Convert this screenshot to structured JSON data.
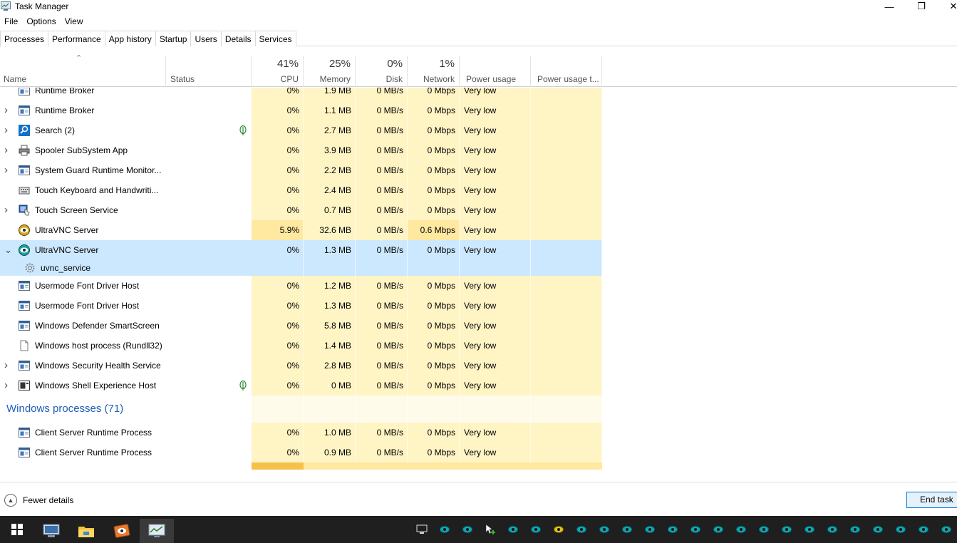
{
  "window": {
    "title": "Task Manager"
  },
  "menu": [
    "File",
    "Options",
    "View"
  ],
  "tabs": [
    "Processes",
    "Performance",
    "App history",
    "Startup",
    "Users",
    "Details",
    "Services"
  ],
  "columns": {
    "name": "Name",
    "status": "Status",
    "cpu": {
      "pct": "41%",
      "label": "CPU"
    },
    "memory": {
      "pct": "25%",
      "label": "Memory"
    },
    "disk": {
      "pct": "0%",
      "label": "Disk"
    },
    "network": {
      "pct": "1%",
      "label": "Network"
    },
    "power": "Power usage",
    "power_trend": "Power usage t..."
  },
  "rows": [
    {
      "kind": "proc",
      "expand": "",
      "icon": "app-window-icon",
      "name": "Runtime Broker",
      "cpu": "0%",
      "mem": "1.9 MB",
      "disk": "0 MB/s",
      "net": "0 Mbps",
      "power": "Very low"
    },
    {
      "kind": "proc",
      "expand": ">",
      "icon": "app-window-icon",
      "name": "Runtime Broker",
      "cpu": "0%",
      "mem": "1.1 MB",
      "disk": "0 MB/s",
      "net": "0 Mbps",
      "power": "Very low"
    },
    {
      "kind": "proc",
      "expand": ">",
      "icon": "search-icon",
      "name": "Search (2)",
      "leaf": true,
      "cpu": "0%",
      "mem": "2.7 MB",
      "disk": "0 MB/s",
      "net": "0 Mbps",
      "power": "Very low"
    },
    {
      "kind": "proc",
      "expand": ">",
      "icon": "printer-icon",
      "name": "Spooler SubSystem App",
      "cpu": "0%",
      "mem": "3.9 MB",
      "disk": "0 MB/s",
      "net": "0 Mbps",
      "power": "Very low"
    },
    {
      "kind": "proc",
      "expand": ">",
      "icon": "app-window-icon",
      "name": "System Guard Runtime Monitor...",
      "cpu": "0%",
      "mem": "2.2 MB",
      "disk": "0 MB/s",
      "net": "0 Mbps",
      "power": "Very low"
    },
    {
      "kind": "proc",
      "expand": "",
      "icon": "keyboard-icon",
      "name": "Touch Keyboard and Handwriti...",
      "cpu": "0%",
      "mem": "2.4 MB",
      "disk": "0 MB/s",
      "net": "0 Mbps",
      "power": "Very low"
    },
    {
      "kind": "proc",
      "expand": ">",
      "icon": "touch-icon",
      "name": "Touch Screen Service",
      "cpu": "0%",
      "mem": "0.7 MB",
      "disk": "0 MB/s",
      "net": "0 Mbps",
      "power": "Very low"
    },
    {
      "kind": "proc",
      "expand": "",
      "icon": "ultravnc-icon",
      "name": "UltraVNC Server",
      "cpu": "5.9%",
      "mem": "32.6 MB",
      "disk": "0 MB/s",
      "net": "0.6 Mbps",
      "power": "Very low",
      "hot": true
    },
    {
      "kind": "proc",
      "expand": "v",
      "icon": "ultravnc-service-icon",
      "name": "UltraVNC Server",
      "cpu": "0%",
      "mem": "1.3 MB",
      "disk": "0 MB/s",
      "net": "0 Mbps",
      "power": "Very low",
      "selected": true
    },
    {
      "kind": "child",
      "icon": "gear-icon",
      "name": "uvnc_service",
      "selected": true
    },
    {
      "kind": "proc",
      "expand": "",
      "icon": "app-window-icon",
      "name": "Usermode Font Driver Host",
      "cpu": "0%",
      "mem": "1.2 MB",
      "disk": "0 MB/s",
      "net": "0 Mbps",
      "power": "Very low"
    },
    {
      "kind": "proc",
      "expand": "",
      "icon": "app-window-icon",
      "name": "Usermode Font Driver Host",
      "cpu": "0%",
      "mem": "1.3 MB",
      "disk": "0 MB/s",
      "net": "0 Mbps",
      "power": "Very low"
    },
    {
      "kind": "proc",
      "expand": "",
      "icon": "app-window-icon",
      "name": "Windows Defender SmartScreen",
      "cpu": "0%",
      "mem": "5.8 MB",
      "disk": "0 MB/s",
      "net": "0 Mbps",
      "power": "Very low"
    },
    {
      "kind": "proc",
      "expand": "",
      "icon": "document-icon",
      "name": "Windows host process (Rundll32)",
      "cpu": "0%",
      "mem": "1.4 MB",
      "disk": "0 MB/s",
      "net": "0 Mbps",
      "power": "Very low"
    },
    {
      "kind": "proc",
      "expand": ">",
      "icon": "app-window-icon",
      "name": "Windows Security Health Service",
      "cpu": "0%",
      "mem": "2.8 MB",
      "disk": "0 MB/s",
      "net": "0 Mbps",
      "power": "Very low"
    },
    {
      "kind": "proc",
      "expand": ">",
      "icon": "shell-icon",
      "name": "Windows Shell Experience Host",
      "leaf": true,
      "cpu": "0%",
      "mem": "0 MB",
      "disk": "0 MB/s",
      "net": "0 Mbps",
      "power": "Very low"
    },
    {
      "kind": "group",
      "name": "Windows processes (71)"
    },
    {
      "kind": "proc",
      "expand": "",
      "icon": "app-window-icon",
      "name": "Client Server Runtime Process",
      "cpu": "0%",
      "mem": "1.0 MB",
      "disk": "0 MB/s",
      "net": "0 Mbps",
      "power": "Very low"
    },
    {
      "kind": "proc",
      "expand": "",
      "icon": "app-window-icon",
      "name": "Client Server Runtime Process",
      "cpu": "0%",
      "mem": "0.9 MB",
      "disk": "0 MB/s",
      "net": "0 Mbps",
      "power": "Very low"
    }
  ],
  "footer": {
    "fewer_details": "Fewer details",
    "end_task": "End task"
  },
  "colors": {
    "heat_light": "#fff4c4",
    "heat_mid": "#ffe8a0",
    "selected": "#cce8ff",
    "group_text": "#1e5eb6"
  },
  "taskbar": {
    "apps": [
      "start-icon",
      "network-app-icon",
      "file-explorer-icon",
      "ultravnc-viewer-icon",
      "task-manager-icon"
    ],
    "tray": [
      "network-tray-icon",
      "vnc-eye-icon",
      "vnc-eye-icon",
      "pointer-add-icon",
      "vnc-eye-icon",
      "vnc-eye-icon",
      "vnc-eye-yellow-icon",
      "vnc-eye-icon",
      "vnc-eye-icon",
      "vnc-eye-icon",
      "vnc-eye-icon",
      "vnc-eye-icon",
      "vnc-eye-icon",
      "vnc-eye-icon",
      "vnc-eye-icon",
      "vnc-eye-icon",
      "vnc-eye-icon",
      "vnc-eye-icon",
      "vnc-eye-icon",
      "vnc-eye-icon",
      "vnc-eye-icon",
      "vnc-eye-icon",
      "vnc-eye-icon",
      "vnc-eye-icon"
    ]
  }
}
